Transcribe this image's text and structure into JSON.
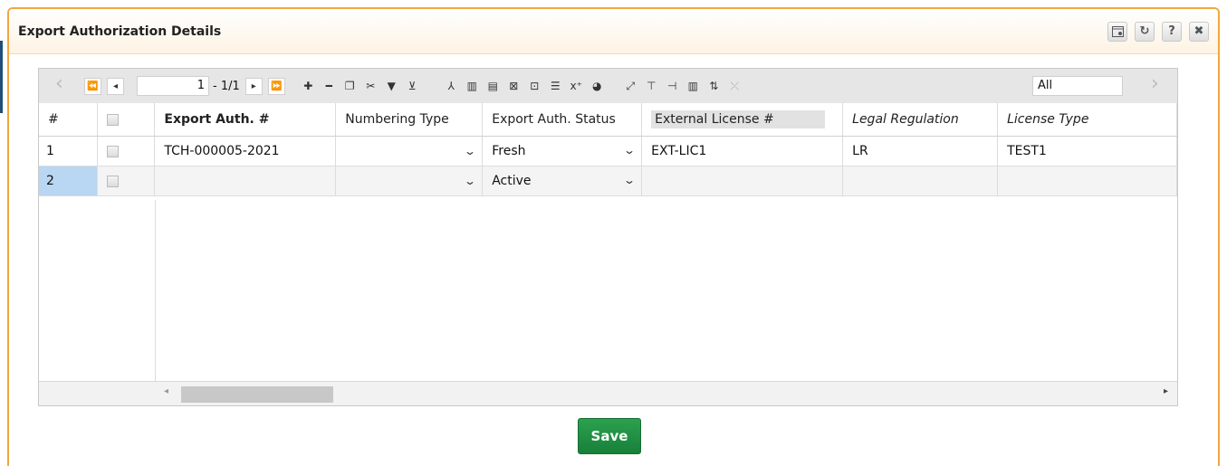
{
  "dialog": {
    "title": "Export Authorization Details",
    "header_buttons": [
      "customize-icon",
      "refresh-icon",
      "help-icon",
      "close-icon"
    ],
    "refresh_glyph": "↻",
    "help_glyph": "?",
    "close_glyph": "✖"
  },
  "toolbar": {
    "page_input": "1",
    "page_total": "- 1/1",
    "search_scope": "All",
    "glyphs": {
      "first": "⏪",
      "prev": "◂",
      "next": "▸",
      "last": "⏩",
      "add": "✚",
      "remove": "━",
      "copy": "❐",
      "cut": "✂",
      "filter": "▼",
      "clear_filter": "⊻",
      "pdf": "⅄",
      "chart": "▥",
      "html5": "▤",
      "excel": "⊠",
      "excel2": "⊡",
      "text": "☰",
      "formula": "x⁺",
      "pie": "◕",
      "expand": "⤢",
      "pin": "⊤",
      "pin2": "⊣",
      "columns": "▥",
      "sort": "⇅",
      "unlink": "⤫",
      "nav_left": "‹",
      "nav_right": "›"
    }
  },
  "table": {
    "columns": [
      "#",
      "",
      "Export Auth. #",
      "Numbering Type",
      "Export Auth. Status",
      "External License #",
      "Legal Regulation",
      "License Type"
    ],
    "rows": [
      {
        "num": "1",
        "export_auth": "TCH-000005-2021",
        "numbering_type": "",
        "status": "Fresh",
        "external_license": "EXT-LIC1",
        "legal_regulation": "LR",
        "license_type": "TEST1"
      },
      {
        "num": "2",
        "export_auth": "",
        "numbering_type": "",
        "status": "Active",
        "external_license": "",
        "legal_regulation": "",
        "license_type": ""
      }
    ],
    "chevron": "⌄"
  },
  "footer": {
    "save_label": "Save"
  }
}
